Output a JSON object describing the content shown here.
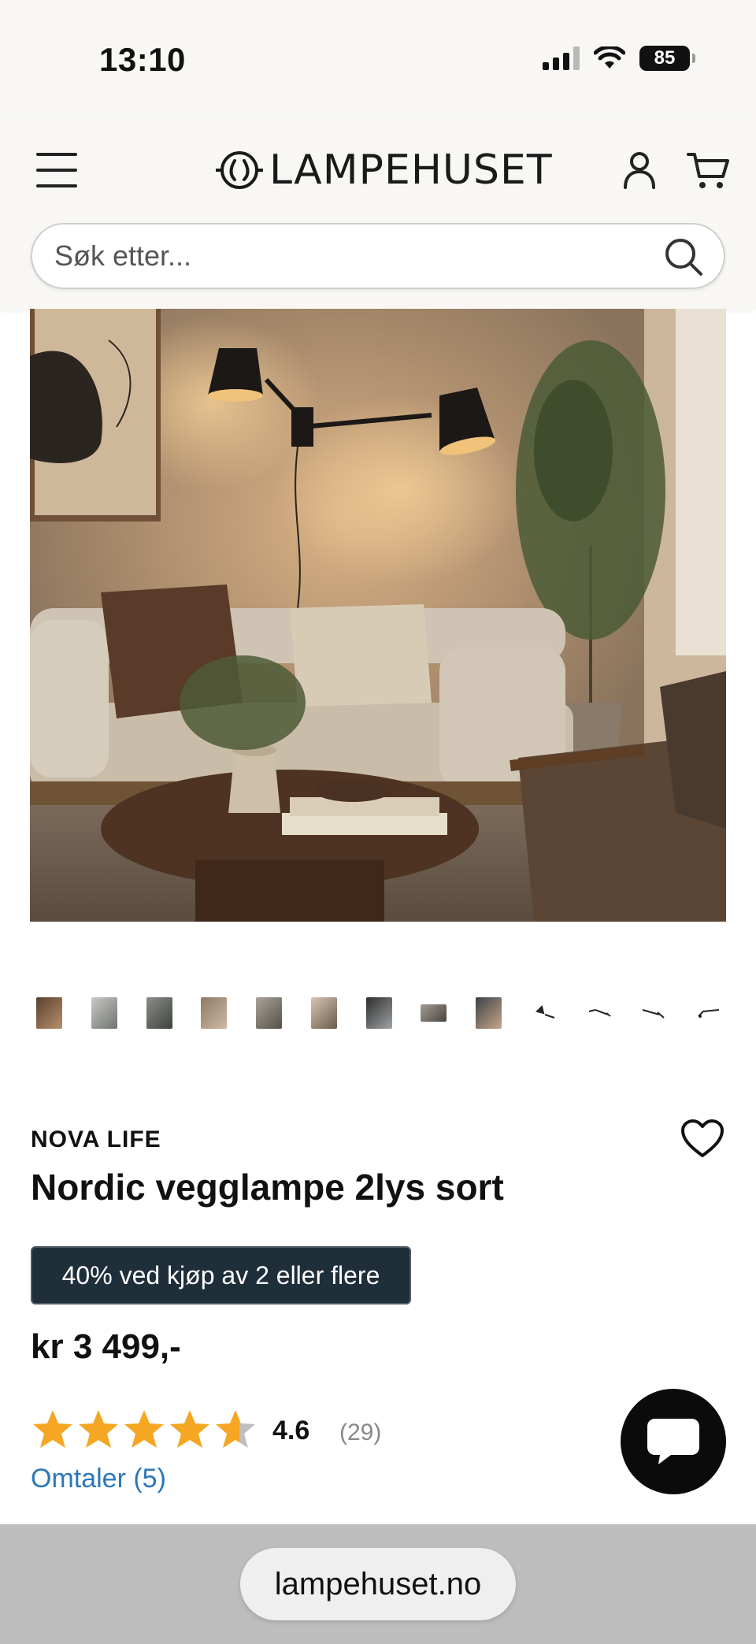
{
  "status_bar": {
    "time": "13:10",
    "battery": "85",
    "icons": [
      "cellular-signal-icon",
      "wifi-icon",
      "battery-icon"
    ]
  },
  "header": {
    "logo_text": "LAMPEHUSET",
    "icons": [
      "hamburger-menu-icon",
      "user-account-icon",
      "shopping-cart-icon",
      "lampehuset-logo-icon"
    ],
    "search_placeholder": "Søk etter...",
    "background": "#f8f7f4"
  },
  "gallery": {
    "thumbnail_count": 13
  },
  "product": {
    "brand": "NOVA LIFE",
    "title": "Nordic vegglampe 2lys sort",
    "promo": "40% ved kjøp av 2 eller flere",
    "price": "kr 3 499,-",
    "rating": "4.6",
    "rating_value": 4.6,
    "rating_max": 5,
    "rating_count": "(29)",
    "reviews_link": "Omtaler (5)"
  },
  "colors": {
    "promo_bg": "#1f2f3a",
    "star": "#f5a623",
    "star_empty": "#bfbfbf",
    "link": "#2b78b8"
  },
  "browser": {
    "url": "lampehuset.no"
  }
}
